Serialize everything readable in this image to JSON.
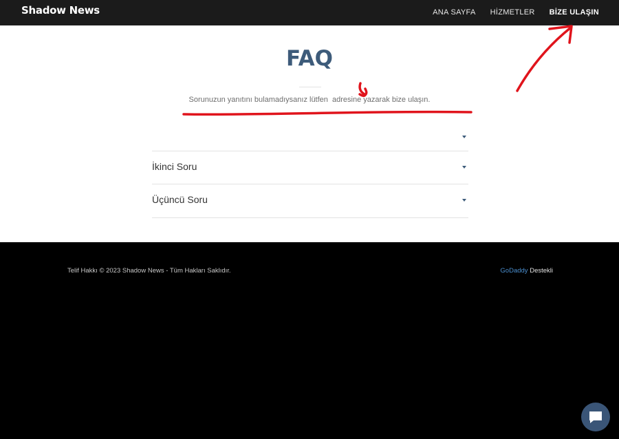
{
  "header": {
    "brand": "Shadow News",
    "nav": [
      "ANA SAYFA",
      "HİZMETLER",
      "BİZE ULAŞIN"
    ]
  },
  "faq": {
    "title": "FAQ",
    "subtitle": "Sorunuzun yanıtını bulamadıysanız lütfen  adresine yazarak bize ulaşın.",
    "items": [
      "",
      "İkinci Soru",
      "Üçüncü Soru"
    ]
  },
  "footer": {
    "copyright": "Telif Hakkı © 2023 Shadow News - Tüm Hakları Saklıdır.",
    "powered_link": "GoDaddy",
    "powered_suffix": " Destekli"
  },
  "colors": {
    "accent": "#3d5b7a",
    "annotation": "#e0141c",
    "header_bg": "#1b1b1b",
    "footer_bg": "#000000"
  },
  "icons": {
    "chat": "chat-bubble-icon",
    "accordion": "caret-down-icon"
  }
}
